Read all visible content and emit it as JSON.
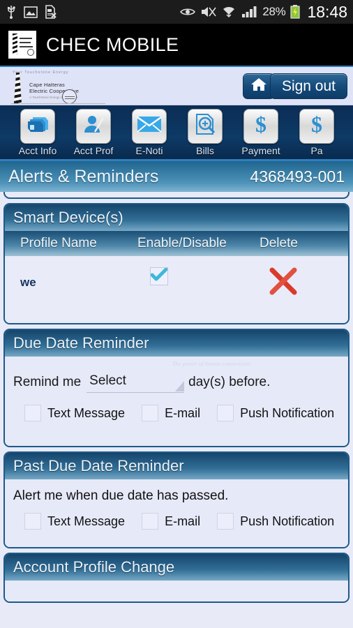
{
  "status_bar": {
    "left_icons": [
      "usb-icon",
      "gallery-icon",
      "sim-card-error-icon"
    ],
    "right_icons": [
      "eye-icon",
      "mute-icon",
      "wifi-icon",
      "signal-icon",
      "battery-charging-icon"
    ],
    "battery_percent": "28%",
    "clock": "18:48"
  },
  "app_bar": {
    "title": "CHEC MOBILE",
    "logo_alt": "chec-logo"
  },
  "coop_bar": {
    "logo_top_text": "Your Touchstone Energy",
    "logo_name_line1": "Cape Hatteras",
    "logo_name_line2": "Electric Cooperative",
    "logo_tagline": "A Touchstone Energy Cooperative",
    "home_label": "home-icon",
    "sign_out_label": "Sign out"
  },
  "icon_nav": {
    "items": [
      {
        "label": "Acct Info",
        "icon": "cards-stack-icon"
      },
      {
        "label": "Acct Prof",
        "icon": "user-profile-icon"
      },
      {
        "label": "E-Noti",
        "icon": "envelope-icon"
      },
      {
        "label": "Bills",
        "icon": "document-search-icon"
      },
      {
        "label": "Payment",
        "icon": "dollar-sign-icon"
      },
      {
        "label": "Pa",
        "icon": "dollar-sign-icon"
      }
    ]
  },
  "page_header": {
    "title": "Alerts & Reminders",
    "account_number": "4368493-001"
  },
  "smart_devices": {
    "title": "Smart Device(s)",
    "columns": [
      "Profile Name",
      "Enable/Disable",
      "Delete"
    ],
    "rows": [
      {
        "profile_name": "we",
        "enabled": true,
        "enable_icon": "check-icon",
        "delete_icon": "red-x-icon"
      }
    ]
  },
  "due_date_reminder": {
    "title": "Due Date Reminder",
    "watermark": "The power of human connections",
    "prefix_label": "Remind me",
    "select_value": "Select",
    "suffix_label": "day(s) before.",
    "channels": [
      {
        "label": "Text Message",
        "checked": false
      },
      {
        "label": "E-mail",
        "checked": false
      },
      {
        "label": "Push Notification",
        "checked": false
      }
    ]
  },
  "past_due_reminder": {
    "title": "Past Due Date Reminder",
    "description": "Alert me when due date has passed.",
    "channels": [
      {
        "label": "Text Message",
        "checked": false
      },
      {
        "label": "E-mail",
        "checked": false
      },
      {
        "label": "Push Notification",
        "checked": false
      }
    ]
  },
  "account_profile_change": {
    "title": "Account Profile Change"
  },
  "colors": {
    "panel_border": "#1c5a86",
    "panel_header_dark": "#15456c",
    "page_bg": "#e8eaf8",
    "accent_blue": "#2f7fbf",
    "button_navy": "#144978",
    "check_cyan": "#3fb8d8",
    "delete_red": "#d93b2b"
  }
}
